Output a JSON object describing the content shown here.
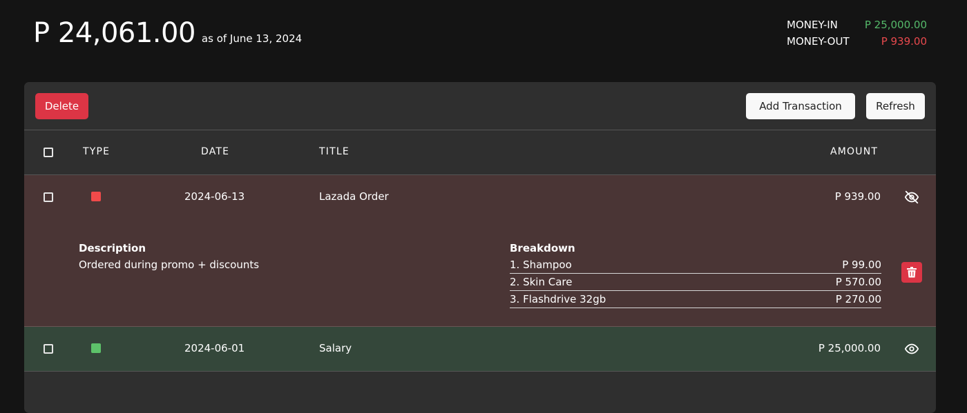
{
  "balance": {
    "amount": "P 24,061.00",
    "as_of": "as of June 13, 2024"
  },
  "summary": {
    "money_in_label": "MONEY-IN",
    "money_in_value": "P 25,000.00",
    "money_out_label": "MONEY-OUT",
    "money_out_value": "P 939.00"
  },
  "toolbar": {
    "delete_label": "Delete",
    "add_label": "Add Transaction",
    "refresh_label": "Refresh"
  },
  "table": {
    "headers": {
      "type": "TYPE",
      "date": "DATE",
      "title": "TITLE",
      "amount": "AMOUNT"
    },
    "rows": [
      {
        "type_color": "#f04a4a",
        "date": "2024-06-13",
        "title": "Lazada Order",
        "amount": "P 939.00",
        "description_label": "Description",
        "description": "Ordered during promo + discounts",
        "breakdown_label": "Breakdown",
        "breakdown": [
          {
            "name": "1. Shampoo",
            "amount": "P 99.00"
          },
          {
            "name": "2. Skin Care",
            "amount": "P 570.00"
          },
          {
            "name": "3. Flashdrive 32gb",
            "amount": "P 270.00"
          }
        ]
      },
      {
        "type_color": "#5dc26a",
        "date": "2024-06-01",
        "title": "Salary",
        "amount": "P 25,000.00"
      }
    ]
  },
  "colors": {
    "background": "#141414",
    "panel": "#2f2f2f",
    "expense_row": "#4a3535",
    "income_row": "#34473a",
    "money_in": "#55b96a",
    "money_out": "#e8494d",
    "danger": "#dc3545"
  },
  "icons": {
    "hide_icon": "eye-slash-icon",
    "show_icon": "eye-icon",
    "trash_icon": "trash-icon"
  }
}
